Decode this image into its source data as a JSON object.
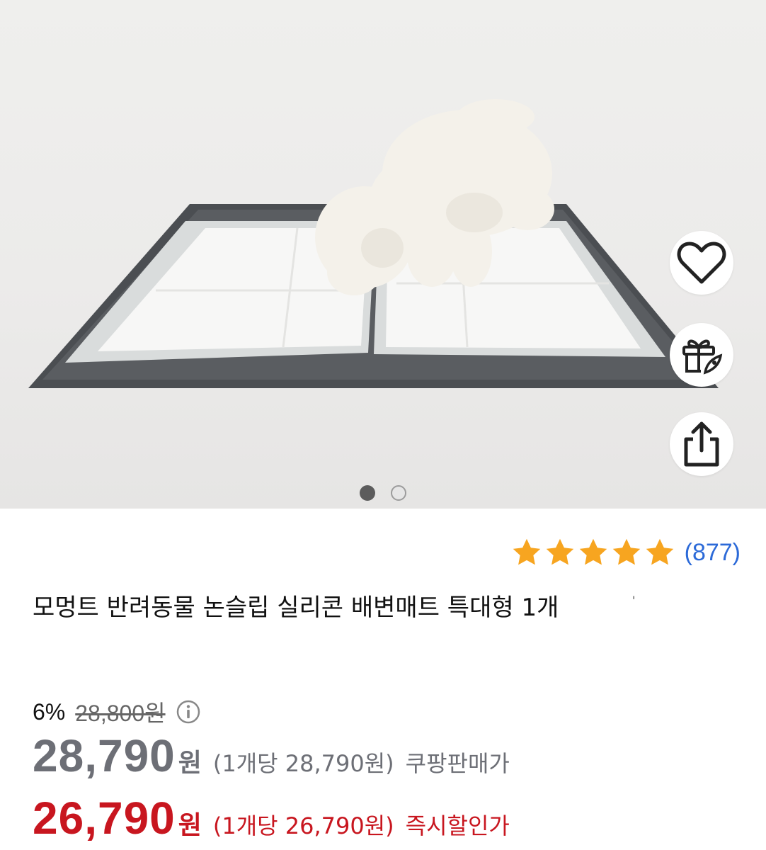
{
  "gallery": {
    "current_index": 1,
    "total": 2
  },
  "actions": {
    "like_icon": "heart-icon",
    "gift_icon": "gift-rocket-icon",
    "share_icon": "share-icon"
  },
  "rating": {
    "stars": 5,
    "count": "(877)"
  },
  "product": {
    "title": "모멍트 반려동물 논슬립 실리콘 배변매트 특대형 1개",
    "title_mark": "'"
  },
  "pricing": {
    "discount_rate": "6%",
    "original_price": "28,800원",
    "base_price": "28,790",
    "base_unit": "원",
    "base_per_unit": "(1개당 28,790원)",
    "base_label": "쿠팡판매가",
    "sale_price": "26,790",
    "sale_unit": "원",
    "sale_per_unit": "(1개당 26,790원)",
    "sale_label": "즉시할인가"
  },
  "colors": {
    "star": "#f7a520",
    "review_count": "#2c6ad8",
    "sale_price": "#c8161f",
    "base_price": "#6d6f76"
  }
}
